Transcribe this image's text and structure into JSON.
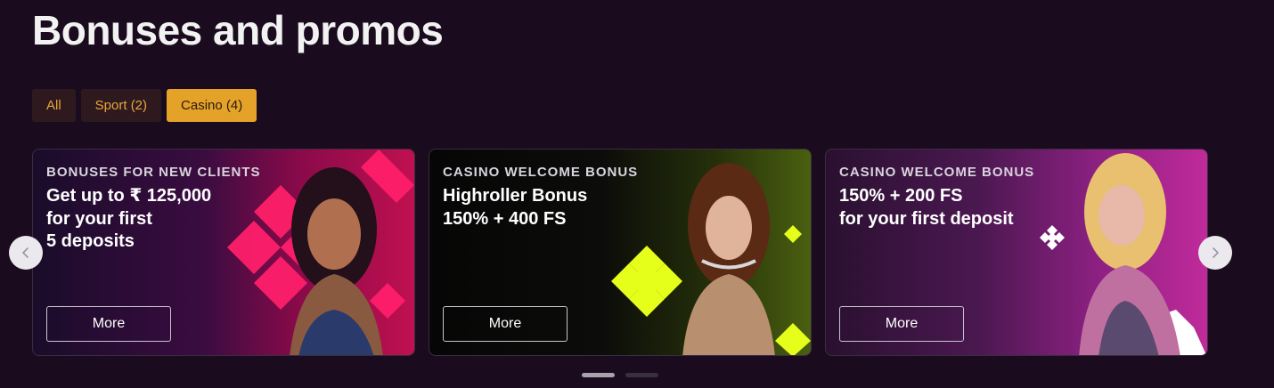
{
  "header": {
    "title": "Bonuses and promos"
  },
  "filters": [
    {
      "label": "All",
      "active": false
    },
    {
      "label": "Sport (2)",
      "active": false
    },
    {
      "label": "Casino (4)",
      "active": true
    }
  ],
  "cards": [
    {
      "kicker": "BONUSES FOR NEW CLIENTS",
      "headline": "Get up to ₹ 125,000\nfor your first\n5 deposits",
      "button": "More"
    },
    {
      "kicker": "CASINO WELCOME BONUS",
      "headline": "Highroller Bonus\n150% + 400 FS",
      "button": "More"
    },
    {
      "kicker": "CASINO WELCOME BONUS",
      "headline": "150% + 200 FS\nfor your first deposit",
      "button": "More"
    }
  ],
  "carousel": {
    "prev_icon": "chevron-left-icon",
    "next_icon": "chevron-right-icon",
    "page_count": 2,
    "active_page": 1
  },
  "colors": {
    "background": "#1a0c1e",
    "accent": "#e4a229",
    "card1_shape": "#ff1f6a",
    "card2_shape": "#e6ff1a",
    "card3_shape": "#ffffff"
  }
}
